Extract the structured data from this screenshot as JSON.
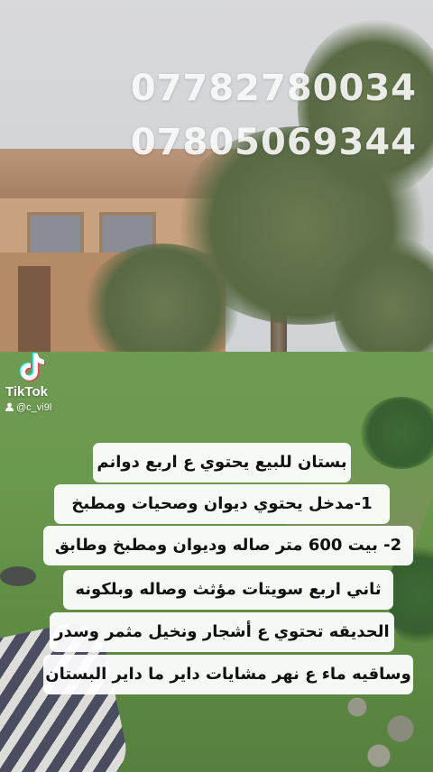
{
  "video": {
    "watermark": {
      "brand": "TikTok",
      "username": "@c_vi9l"
    },
    "overlay_phone_numbers": [
      "07782780034",
      "07805069344"
    ],
    "caption_lines": [
      "بستان للبيع يحتوي ع اربع دوانم",
      "1-مدخل يحتوي ديوان وصحيات ومطبخ",
      "2- بيت 600 متر صاله وديوان ومطبخ وطابق",
      "ثاني اربع سويتات مؤثث وصاله وبلكونه",
      "الحديقه تحتوي ع أشجار ونخيل مثمر وسدر",
      "وساقيه ماء ع نهر مشايات داير ما داير البستان"
    ]
  },
  "icons": {
    "tiktok_logo": "tiktok-logo-icon",
    "user": "user-icon"
  },
  "colors": {
    "caption_background": "#FFFFFF",
    "caption_text": "#111111",
    "overlay_text": "#FFFFFF"
  }
}
